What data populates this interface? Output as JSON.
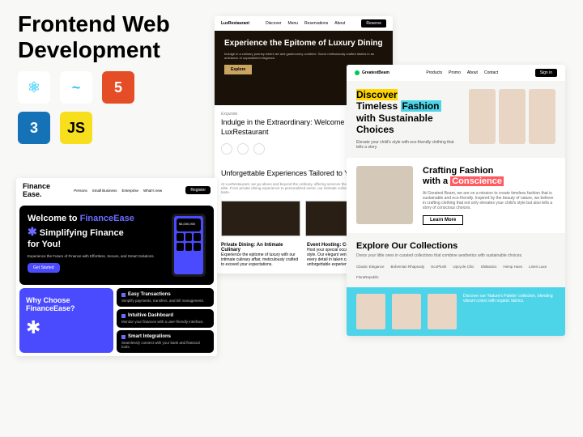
{
  "page_title_line1": "Frontend Web",
  "page_title_line2": "Development",
  "tech": {
    "react": "⚛",
    "tailwind": "~",
    "html": "5",
    "css": "3",
    "js": "JS"
  },
  "lux": {
    "brand": "LuxRestaurant",
    "nav": [
      "Discover",
      "Menu",
      "Reservations",
      "About"
    ],
    "cta": "Reserve",
    "hero_title": "Experience the Epitome of Luxury Dining",
    "hero_sub": "Indulge in a culinary journey where art and gastronomy combine. Savor meticulously crafted dishes in an ambiance of unparalleled elegance.",
    "hero_btn": "Explore",
    "tag": "Exquisite",
    "intro": "Indulge in the Extraordinary: Welcome to LuxRestaurant",
    "exp_title": "Unforgettable Experiences Tailored to Your Desires",
    "exp_sub": "At LuxRestaurant, we go above and beyond the ordinary, offering services that cater to the discerning elite. From private dining experience to personalized event, our intimate culinary is tailored to your taste.",
    "card1_t": "Private Dining: An Intimate Culinary",
    "card1_p": "Experience the epitome of luxury with our intimate culinary affair, meticulously crafted to exceed your expectations.",
    "card2_t": "Event Hosting: Celebrate in Style",
    "card2_p": "Host your special occasions in exquisite style. Our elegant venue sets the stage for every detail in taken care of an unforgettable experience."
  },
  "gb": {
    "brand": "GreatestBeam",
    "nav": [
      "Products",
      "Promo",
      "About",
      "Contact"
    ],
    "signin": "Sign in",
    "hero_discover": "Discover",
    "hero_l2a": "Timeless",
    "hero_l2b": "Fashion",
    "hero_l3": "with Sustainable",
    "hero_l4": "Choices",
    "hero_p": "Elevate your child's style with eco-friendly clothing that tells a story.",
    "craft_l1": "Crafting Fashion",
    "craft_l2a": "with a",
    "craft_l2b": "Conscience",
    "craft_p": "At Greatest Beam, we are on a mission to create timeless fashion that is sustainable and eco-friendly. Inspired by the beauty of nature, we believe in crafting clothing that not only elevates your child's style but also tells a story of conscious choices.",
    "learn": "Learn More",
    "coll_t": "Explore Our Collections",
    "coll_p": "Dress your little ones in curated collections that combine aesthetics with sustainable choices.",
    "cats": [
      "Classic Elegance",
      "Bohemian Rhapsody",
      "EcoPlush",
      "Upcycle Chic",
      "ShiBasics",
      "Hemp Hues",
      "Linen Luxe",
      "FloraRepublic"
    ],
    "banner_p": "Discover our 'Nature's Palette' collection, blending vibrant colors with organic fabrics."
  },
  "fe": {
    "brand1": "Finance",
    "brand2": "Ease.",
    "nav": [
      "Persons",
      "Small Business",
      "Enterprise",
      "What's new"
    ],
    "reg": "Register",
    "hero_l1": "Welcome to",
    "hero_l1b": "FinanceEase",
    "hero_l2": "Simplifying Finance",
    "hero_l3": "for You!",
    "hero_p": "Experience the Future of Finance with Effortless, Secure, and Smart Solutions.",
    "gs": "Get Started",
    "bal": "$4,000,000",
    "why": "Why Choose FinanceEase?",
    "f1_t": "Easy Transactions",
    "f1_p": "Simplify payments, transfers, and bill management.",
    "f2_t": "Intuitive Dashboard",
    "f2_p": "Monitor your finances with a user-friendly interface.",
    "f3_t": "Smart Integrations",
    "f3_p": "Seamlessly connect with your bank and financial tools."
  }
}
